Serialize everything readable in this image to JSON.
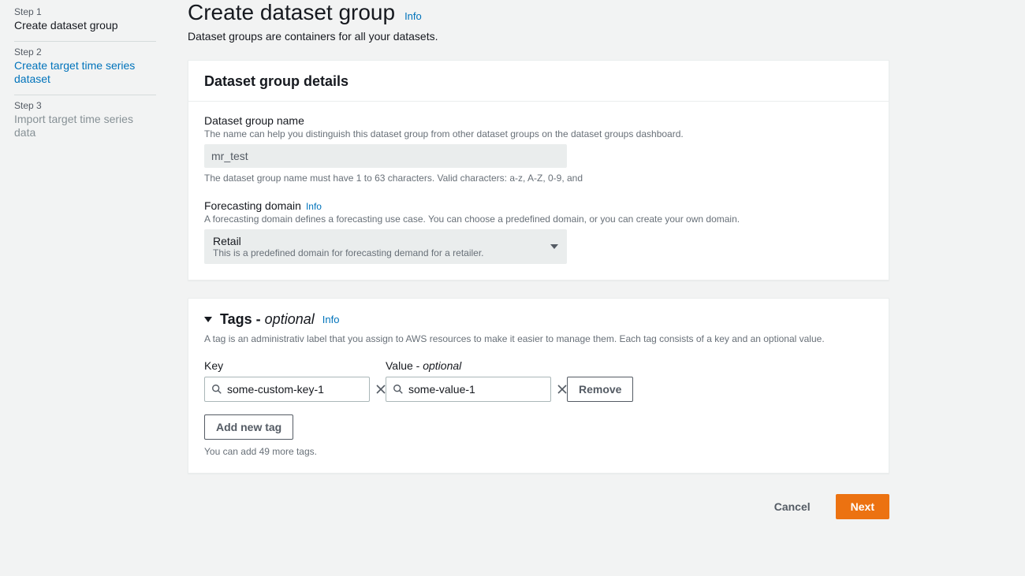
{
  "sidebar": {
    "steps": [
      {
        "num": "Step 1",
        "title": "Create dataset group"
      },
      {
        "num": "Step 2",
        "title": "Create target time series dataset"
      },
      {
        "num": "Step 3",
        "title": "Import target time series data"
      }
    ]
  },
  "page": {
    "title": "Create dataset group",
    "info_label": "Info",
    "description": "Dataset groups are containers for all your datasets."
  },
  "details": {
    "header": "Dataset group details",
    "name": {
      "label": "Dataset group name",
      "help": "The name can help you distinguish this dataset group from other dataset groups on the dataset groups dashboard.",
      "value": "mr_test",
      "hint": "The dataset group name must have 1 to 63 characters. Valid characters: a-z, A-Z, 0-9, and"
    },
    "domain": {
      "label": "Forecasting domain",
      "info_label": "Info",
      "help": "A forecasting domain defines a forecasting use case. You can choose a predefined domain, or you can create your own domain.",
      "selected_title": "Retail",
      "selected_desc": "This is a predefined domain for forecasting demand for a retailer."
    }
  },
  "tags": {
    "header_prefix": "Tags - ",
    "header_optional": "optional",
    "info_label": "Info",
    "description": "A tag is an administrativ label that you assign to AWS resources to make it easier to manage them. Each tag consists of a key and an optional value.",
    "key_label": "Key",
    "value_label_prefix": "Value - ",
    "value_label_optional": "optional",
    "row": {
      "key": "some-custom-key-1",
      "value": "some-value-1"
    },
    "remove_label": "Remove",
    "add_label": "Add new tag",
    "remaining": "You can add 49 more tags."
  },
  "footer": {
    "cancel": "Cancel",
    "next": "Next"
  }
}
